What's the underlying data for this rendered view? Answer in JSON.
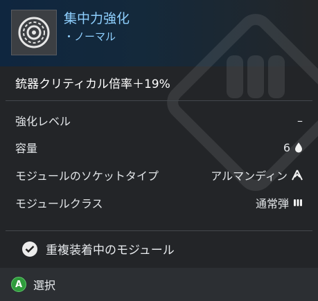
{
  "module": {
    "name": "集中力強化",
    "rarity": "・ノーマル",
    "effect": "銃器クリティカル倍率＋19%"
  },
  "stats": [
    {
      "label": "強化レベル",
      "value": "–",
      "icon": ""
    },
    {
      "label": "容量",
      "value": "6",
      "icon": "capacity-drop-icon"
    },
    {
      "label": "モジュールのソケットタイプ",
      "value": "アルマンディン",
      "icon": "almandine-socket-icon"
    },
    {
      "label": "モジュールクラス",
      "value": "通常弾",
      "icon": "general-rounds-icon"
    }
  ],
  "equipped_label": "重複装着中のモジュール",
  "footer": {
    "button": "A",
    "action": "選択"
  },
  "colors": {
    "accent": "#8fd0ff",
    "panel": "#232528",
    "button_green": "#2f9b3c"
  }
}
